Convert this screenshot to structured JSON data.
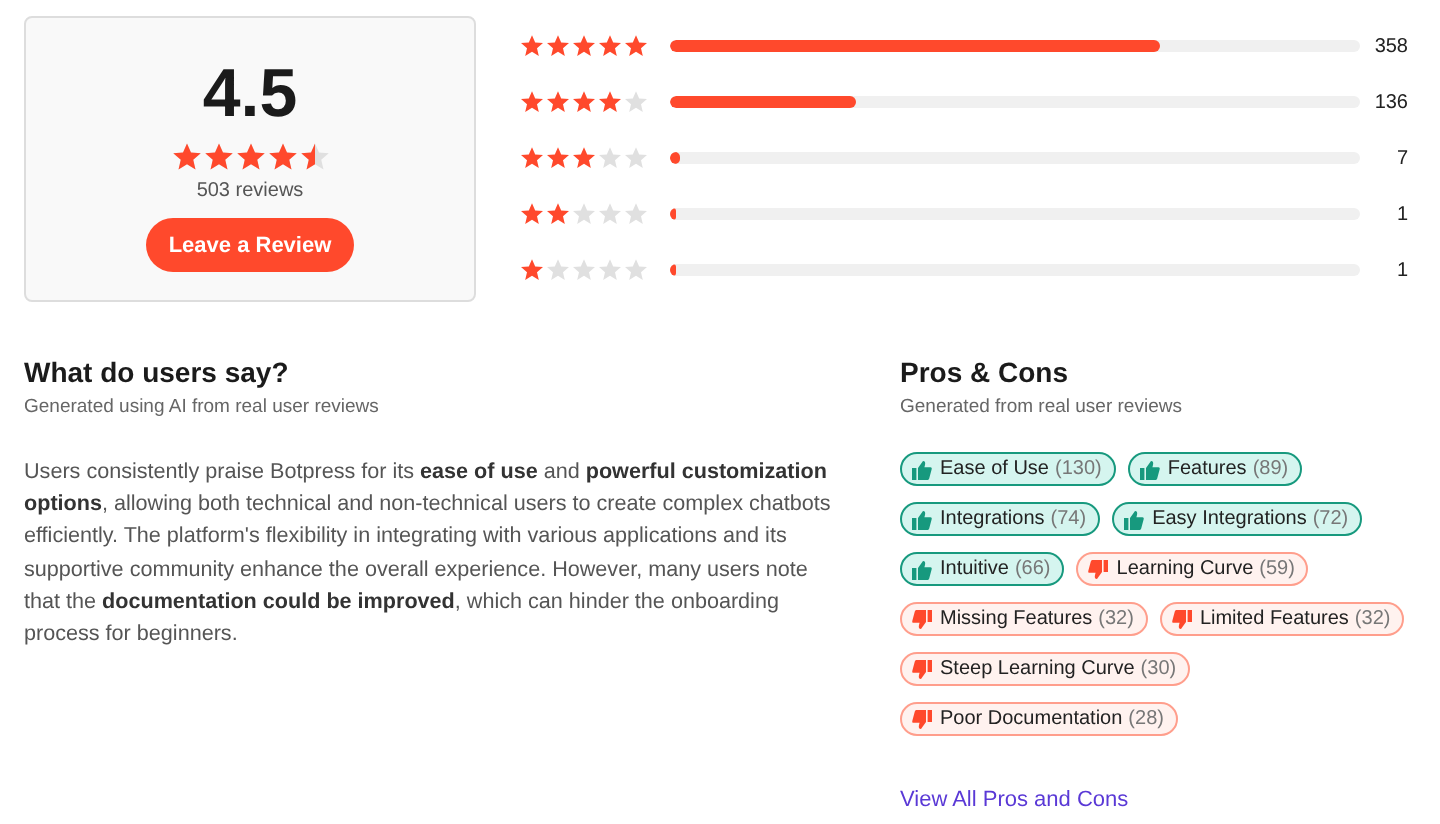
{
  "summary": {
    "score": "4.5",
    "stars": 4.5,
    "review_count": "503 reviews",
    "button": "Leave a Review"
  },
  "distribution": [
    {
      "stars": 5,
      "level": 0.71,
      "count": "358"
    },
    {
      "stars": 4,
      "level": 0.27,
      "count": "136"
    },
    {
      "stars": 3,
      "level": 0.014,
      "count": "7"
    },
    {
      "stars": 2,
      "level": 0.003,
      "count": "1"
    },
    {
      "stars": 1,
      "level": 0.003,
      "count": "1"
    }
  ],
  "what_users_say": {
    "title": "What do users say?",
    "subtitle": "Generated using AI from real user reviews",
    "text": "Users consistently praise Botpress for its **ease of use** and **powerful customization options**, allowing both technical and non-technical users to create complex chatbots efficiently. The platform's flexibility in integrating with various applications and its supportive community enhance the overall experience. However, many users note that the **documentation could be improved**, which can hinder the onboarding process for beginners."
  },
  "pros_cons": {
    "title": "Pros & Cons",
    "subtitle": "Generated from real user reviews",
    "tags": [
      {
        "kind": "pro",
        "label": "Ease of Use",
        "count": "(130)"
      },
      {
        "kind": "pro",
        "label": "Features",
        "count": "(89)"
      },
      {
        "kind": "pro",
        "label": "Integrations",
        "count": "(74)"
      },
      {
        "kind": "pro",
        "label": "Easy Integrations",
        "count": "(72)"
      },
      {
        "kind": "pro",
        "label": "Intuitive",
        "count": "(66)"
      },
      {
        "kind": "con",
        "label": "Learning Curve",
        "count": "(59)"
      },
      {
        "kind": "con",
        "label": "Missing Features",
        "count": "(32)"
      },
      {
        "kind": "con",
        "label": "Limited Features",
        "count": "(32)"
      },
      {
        "kind": "con",
        "label": "Steep Learning Curve",
        "count": "(30)"
      },
      {
        "kind": "con",
        "label": "Poor Documentation",
        "count": "(28)"
      }
    ],
    "link": "View All Pros and Cons"
  }
}
